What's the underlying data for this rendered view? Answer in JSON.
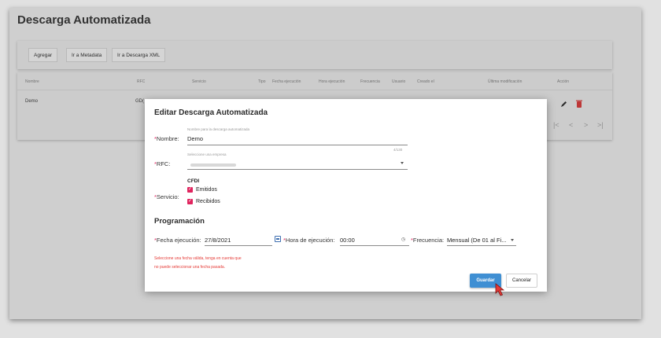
{
  "page": {
    "title": "Descarga Automatizada"
  },
  "toolbar": {
    "add_label": "Agregar",
    "metadata_label": "Ir a Metadata",
    "xml_label": "Ir a Descarga XML"
  },
  "table": {
    "headers": [
      "Nombre",
      "RFC",
      "Servicio",
      "Tipo",
      "Fecha ejecución",
      "Hora ejecución",
      "Frecuencia",
      "Usuario",
      "Creado el",
      "Última modificación",
      "Acción"
    ],
    "row": {
      "nombre": "Demo",
      "rfc": "GD("
    },
    "pagination": {
      "first": "|<",
      "prev": "<",
      "next": ">",
      "last": ">|"
    }
  },
  "modal": {
    "title": "Editar Descarga Automatizada",
    "required_mark": "*",
    "nombre": {
      "label": "Nombre:",
      "hint": "Nombre para la descarga automatizada",
      "value": "Demo",
      "counter": "4/130"
    },
    "rfc": {
      "label": "RFC:",
      "hint": "Seleccione una empresa"
    },
    "servicio": {
      "label": "Servicio:",
      "group": "CFDI",
      "options": [
        "Emitidos",
        "Recibidos"
      ]
    },
    "section": "Programación",
    "fecha": {
      "label": "Fecha ejecución:",
      "value": "27/8/2021"
    },
    "hora": {
      "label": "Hora de ejecución:",
      "value": "00:00"
    },
    "frecuencia": {
      "label": "Frecuencia:",
      "value": "Mensual (De 01 al Fi..."
    },
    "error_line1": "Seleccione una fecha válida, tenga en cuenta que",
    "error_line2": "no puede seleccionar una fecha pasada.",
    "save_label": "Guardar",
    "cancel_label": "Cancelar"
  },
  "colors": {
    "accent": "#e0245e",
    "primary_button": "#3f8fd3",
    "error": "#e53935"
  }
}
